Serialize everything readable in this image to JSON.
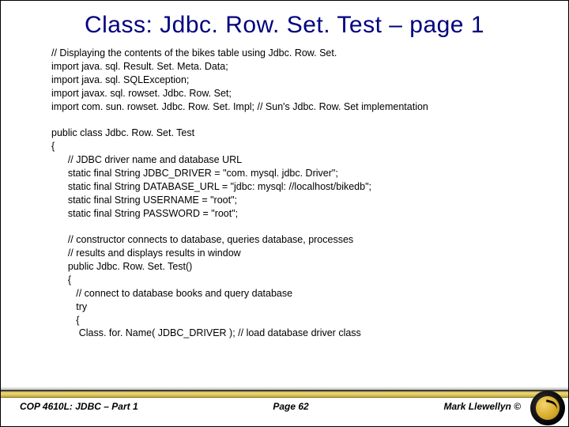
{
  "title": "Class:  Jdbc. Row. Set. Test – page 1",
  "code": "// Displaying the contents of the bikes table using Jdbc. Row. Set.\nimport java. sql. Result. Set. Meta. Data;\nimport java. sql. SQLException;\nimport javax. sql. rowset. Jdbc. Row. Set;\nimport com. sun. rowset. Jdbc. Row. Set. Impl; // Sun's Jdbc. Row. Set implementation\n\npublic class Jdbc. Row. Set. Test\n{\n      // JDBC driver name and database URL\n      static final String JDBC_DRIVER = \"com. mysql. jdbc. Driver\";\n      static final String DATABASE_URL = \"jdbc: mysql: //localhost/bikedb\";\n      static final String USERNAME = \"root\";\n      static final String PASSWORD = \"root\";\n\n      // constructor connects to database, queries database, processes\n      // results and displays results in window\n      public Jdbc. Row. Set. Test()\n      {\n         // connect to database books and query database\n         try\n         {\n          Class. for. Name( JDBC_DRIVER ); // load database driver class",
  "footer": {
    "left": "COP 4610L: JDBC – Part 1",
    "center": "Page 62",
    "right": "Mark Llewellyn ©"
  }
}
